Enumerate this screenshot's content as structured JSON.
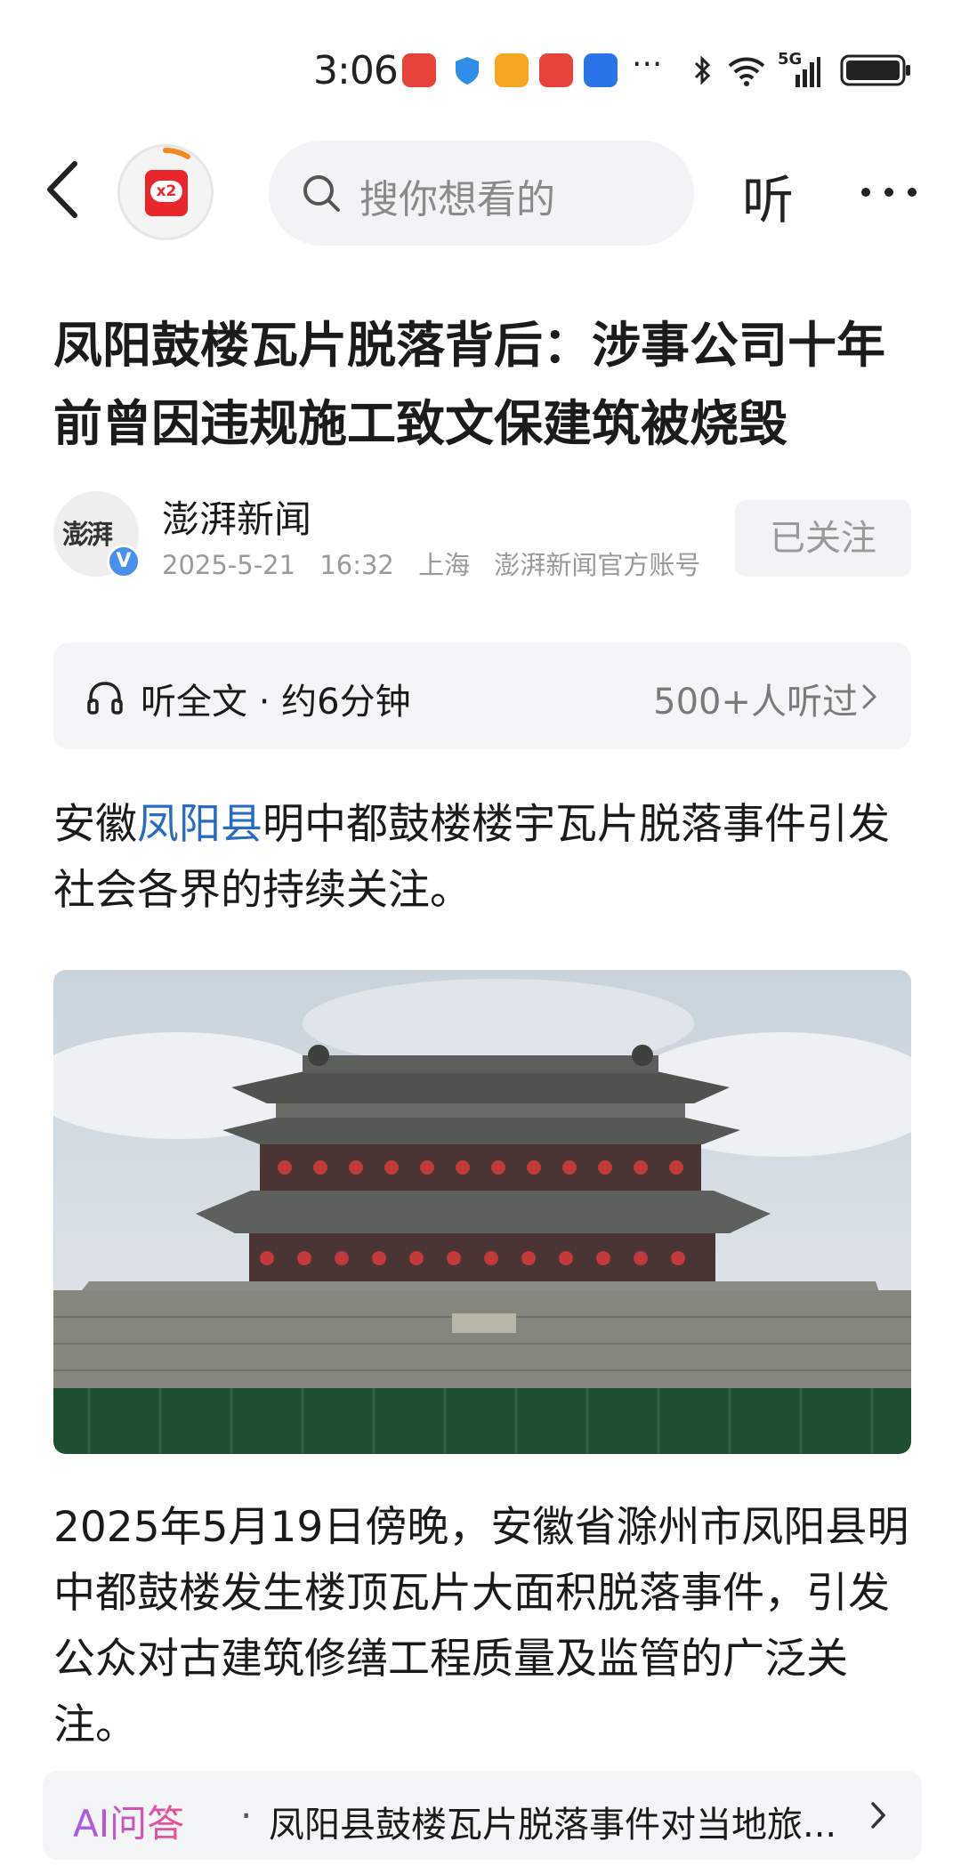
{
  "status_bar": {
    "time": "3:06",
    "network": "5G",
    "app_icons": [
      "huawei-appgallery-icon",
      "shield-icon",
      "weibo-icon",
      "sf-express-icon",
      "app-icon",
      "more-notifications-icon"
    ],
    "system_icons": [
      "bluetooth-icon",
      "wifi-icon",
      "signal-icon",
      "battery-icon"
    ],
    "more": "···"
  },
  "header": {
    "red_packet_badge": "x2",
    "search_placeholder": "搜你想看的",
    "listen_label": "听"
  },
  "article": {
    "title": "凤阳鼓楼瓦片脱落背后：涉事公司十年前曾因违规施工致文保建筑被烧毁",
    "author": {
      "name": "澎湃新闻",
      "avatar_text": "澎湃",
      "date": "2025-5-21",
      "time": "16:32",
      "location": "上海",
      "account_type": "澎湃新闻官方账号",
      "verified_mark": "V"
    },
    "follow_label": "已关注",
    "listen_bar": {
      "label": "听全文 · 约6分钟",
      "count": "500+人听过"
    },
    "paragraph1": {
      "prefix": "安徽",
      "link": "凤阳县",
      "suffix": "明中都鼓楼楼宇瓦片脱落事件引发社会各界的持续关注。"
    },
    "paragraph2": "2025年5月19日傍晚，安徽省滁州市凤阳县明中都鼓楼发生楼顶瓦片大面积脱落事件，引发公众对古建筑修缮工程质量及监管的广泛关注。"
  },
  "ai_bar": {
    "label": "AI问答",
    "separator": "·",
    "question": "凤阳县鼓楼瓦片脱落事件对当地旅..."
  },
  "colors": {
    "link_blue": "#2a6bc2",
    "brand_red": "#e8262b",
    "ai_gradient_start": "#a25cf0",
    "ai_gradient_end": "#f0508e"
  }
}
